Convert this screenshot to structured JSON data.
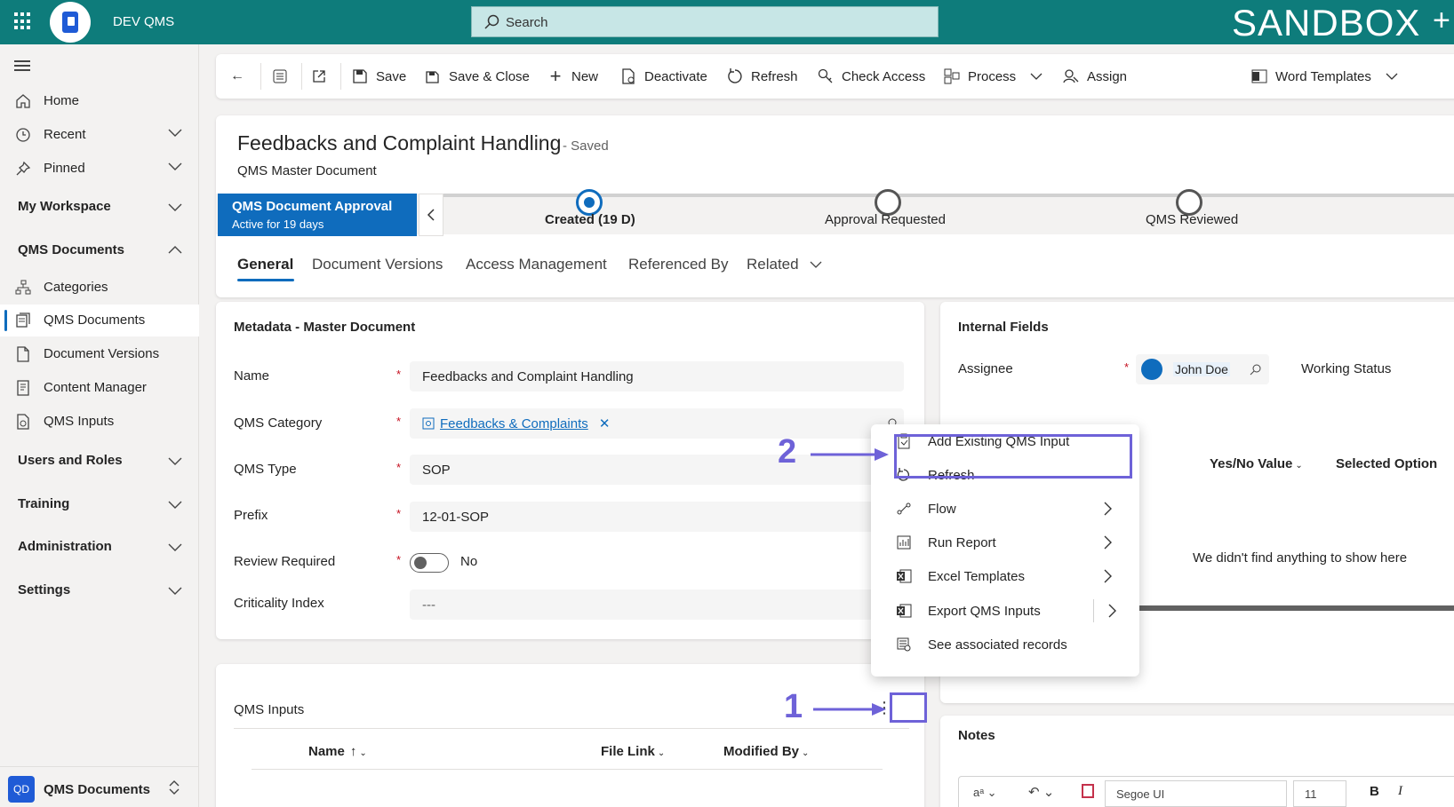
{
  "topbar": {
    "app_name": "DEV QMS",
    "search_placeholder": "Search",
    "env_label": "SANDBOX",
    "add_glyph": "+"
  },
  "sidebar": {
    "items": [
      {
        "label": "Home",
        "icon": "home-icon"
      },
      {
        "label": "Recent",
        "icon": "clock-icon"
      },
      {
        "label": "Pinned",
        "icon": "pin-icon"
      }
    ],
    "groups": {
      "my_workspace": "My Workspace",
      "qms_documents": "QMS Documents",
      "users_roles": "Users and Roles",
      "training": "Training",
      "administration": "Administration",
      "settings": "Settings"
    },
    "qms_items": [
      {
        "label": "Categories",
        "icon": "hierarchy-icon"
      },
      {
        "label": "QMS Documents",
        "icon": "documents-icon"
      },
      {
        "label": "Document Versions",
        "icon": "document-icon"
      },
      {
        "label": "Content Manager",
        "icon": "content-icon"
      },
      {
        "label": "QMS Inputs",
        "icon": "inputs-icon"
      }
    ],
    "area": {
      "badge": "QD",
      "label": "QMS Documents"
    }
  },
  "commands": {
    "save": "Save",
    "save_close": "Save & Close",
    "new": "New",
    "deactivate": "Deactivate",
    "refresh": "Refresh",
    "check_access": "Check Access",
    "process": "Process",
    "assign": "Assign",
    "word_templates": "Word Templates"
  },
  "record": {
    "title": "Feedbacks and Complaint Handling",
    "status": "- Saved",
    "entity": "QMS Master Document"
  },
  "bpf": {
    "stage_name": "QMS Document Approval",
    "stage_sub": "Active for 19 days",
    "stages": [
      "Created  (19 D)",
      "Approval Requested",
      "QMS Reviewed"
    ]
  },
  "tabs": [
    "General",
    "Document Versions",
    "Access Management",
    "Referenced By",
    "Related"
  ],
  "metadata": {
    "title": "Metadata - Master Document",
    "fields": {
      "name_label": "Name",
      "name_value": "Feedbacks and Complaint Handling",
      "category_label": "QMS Category",
      "category_value": "Feedbacks & Complaints",
      "type_label": "QMS Type",
      "type_value": "SOP",
      "prefix_label": "Prefix",
      "prefix_value": "12-01-SOP",
      "review_label": "Review Required",
      "review_value": "No",
      "criticality_label": "Criticality Index",
      "criticality_value": "---"
    },
    "required_mark": "*"
  },
  "internal": {
    "title": "Internal Fields",
    "assignee_label": "Assignee",
    "assignee_value": "John Doe",
    "working_status_label": "Working Status",
    "grid_cols": [
      "Yes/No Value",
      "Selected Option"
    ],
    "empty_msg": "We didn't find anything to show here"
  },
  "qms_inputs": {
    "title": "QMS Inputs",
    "more_glyph": "⋮",
    "cols": [
      "Name",
      "File Link",
      "Modified By"
    ]
  },
  "notes": {
    "title": "Notes",
    "font_name": "Segoe UI",
    "font_size": "11"
  },
  "menu": {
    "items": [
      {
        "label": "Add Existing QMS Input",
        "icon": "add-existing-icon"
      },
      {
        "label": "Refresh",
        "icon": "refresh-icon"
      },
      {
        "label": "Flow",
        "icon": "flow-icon"
      },
      {
        "label": "Run Report",
        "icon": "report-icon"
      },
      {
        "label": "Excel Templates",
        "icon": "excel-icon"
      },
      {
        "label": "Export QMS Inputs",
        "icon": "export-excel-icon"
      },
      {
        "label": "See associated records",
        "icon": "associated-records-icon"
      }
    ]
  },
  "annotations": {
    "step1": "1",
    "step2": "2",
    "color": "#6e62d8"
  }
}
